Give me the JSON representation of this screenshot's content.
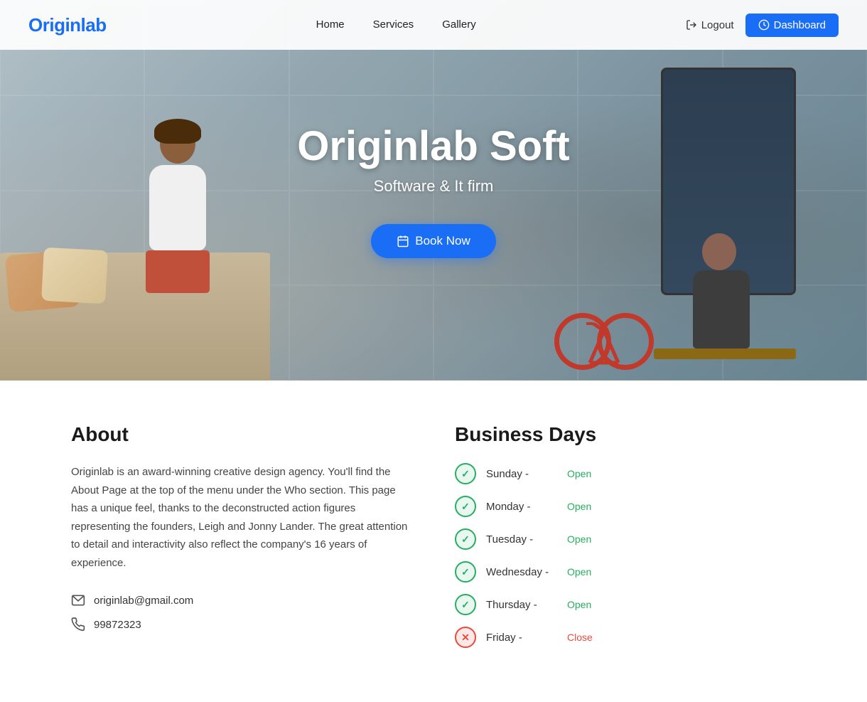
{
  "brand": {
    "name": "Originlab"
  },
  "navbar": {
    "links": [
      {
        "id": "home",
        "label": "Home"
      },
      {
        "id": "services",
        "label": "Services"
      },
      {
        "id": "gallery",
        "label": "Gallery"
      }
    ],
    "logout_label": "Logout",
    "dashboard_label": "Dashboard"
  },
  "hero": {
    "title": "Originlab Soft",
    "subtitle": "Software & It firm",
    "cta_label": "Book Now"
  },
  "about": {
    "heading": "About",
    "text": "Originlab is an award-winning creative design agency. You'll find the About Page at the top of the menu under the Who section. This page has a unique feel, thanks to the deconstructed action figures representing the founders, Leigh and Jonny Lander. The great attention to detail and interactivity also reflect the company's 16 years of experience.",
    "email": "originlab@gmail.com",
    "phone": "99872323"
  },
  "business_days": {
    "heading": "Business Days",
    "days": [
      {
        "name": "Sunday",
        "status": "Open",
        "open": true
      },
      {
        "name": "Monday",
        "status": "Open",
        "open": true
      },
      {
        "name": "Tuesday",
        "status": "Open",
        "open": true
      },
      {
        "name": "Wednesday",
        "status": "Open",
        "open": true
      },
      {
        "name": "Thursday",
        "status": "Open",
        "open": true
      },
      {
        "name": "Friday",
        "status": "Close",
        "open": false
      }
    ]
  }
}
